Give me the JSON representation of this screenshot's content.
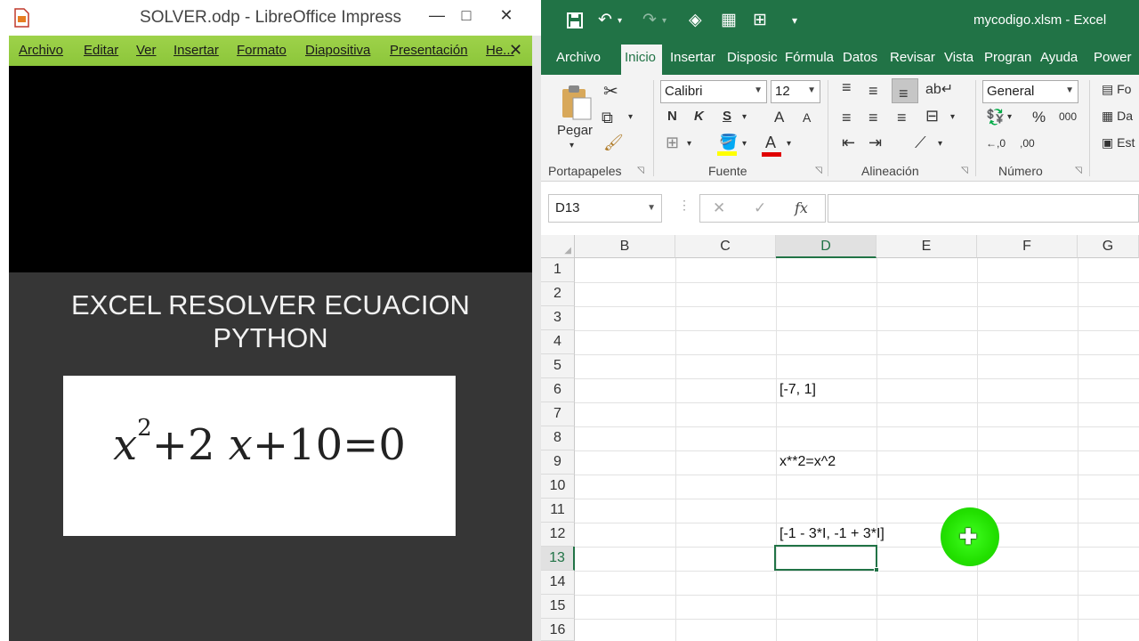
{
  "lo": {
    "title": "SOLVER.odp - LibreOffice Impress",
    "minimize_glyph": "—",
    "maximize_glyph": "□",
    "close_glyph": "✕",
    "menu": [
      "Archivo",
      "Editar",
      "Ver",
      "Insertar",
      "Formato",
      "Diapositiva",
      "Presentación",
      "He..."
    ],
    "menu_close_glyph": "✕",
    "slide_title_line1": "EXCEL RESOLVER ECUACION",
    "slide_title_line2": "PYTHON",
    "formula": {
      "var": "x",
      "exp": "2",
      "plus1": "+",
      "coef": "2",
      "var2": "x",
      "plus2": "+",
      "const": "10",
      "eq": "=",
      "rhs": "0"
    },
    "colors": {
      "menubar": "#8cc63a",
      "slide_bg": "#363636"
    }
  },
  "xl": {
    "title": "mycodigo.xlsm  -  Excel",
    "qat_icons": [
      "save-icon",
      "undo-icon",
      "redo-icon",
      "format-painter-icon",
      "table-icon",
      "pivot-icon",
      "customize-icon"
    ],
    "tabs": [
      "Archivo",
      "Inicio",
      "Insertar",
      "Disposic",
      "Fórmula",
      "Datos",
      "Revisar",
      "Vista",
      "Progran",
      "Ayuda",
      "Power"
    ],
    "active_tab": "Inicio",
    "ribbon": {
      "paste_label": "Pegar",
      "groups": [
        "Portapapeles",
        "Fuente",
        "Alineación",
        "Número"
      ],
      "font_name": "Calibri",
      "font_size": "12",
      "number_format": "General",
      "bold": "N",
      "italic": "K",
      "underline": "S",
      "grow_font": "A",
      "shrink_font": "A",
      "percent": "%",
      "thousands": "000",
      "inc_decimal": "←,0",
      "dec_decimal": ",00",
      "styles": [
        "Fo",
        "Da",
        "Est"
      ]
    },
    "namebox": "D13",
    "formula_bar": "",
    "fx_label": "fx",
    "cancel_glyph": "✕",
    "enter_glyph": "✓",
    "columns": [
      "B",
      "C",
      "D",
      "E",
      "F",
      "G"
    ],
    "selected_column": "D",
    "rows": [
      "1",
      "2",
      "3",
      "4",
      "5",
      "6",
      "7",
      "8",
      "9",
      "10",
      "11",
      "12",
      "13",
      "14",
      "15",
      "16"
    ],
    "selected_row": "13",
    "cells": {
      "D6": "[-7, 1]",
      "D9": "x**2=x^2",
      "D12": "[-1 - 3*I, -1 + 3*I]"
    },
    "cursor_glyph": "✚",
    "colors": {
      "brand": "#217346"
    }
  }
}
